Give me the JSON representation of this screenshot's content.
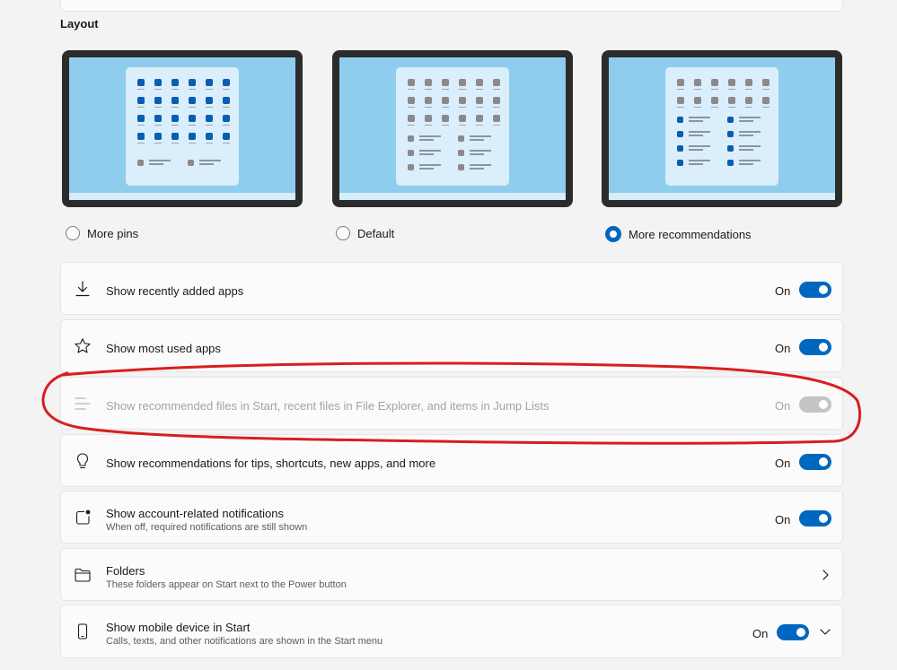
{
  "section": {
    "title": "Layout"
  },
  "layout_options": [
    {
      "label": "More pins",
      "selected": false
    },
    {
      "label": "Default",
      "selected": false
    },
    {
      "label": "More recommendations",
      "selected": true
    }
  ],
  "settings": [
    {
      "icon": "download-icon",
      "label": "Show recently added apps",
      "state": "On",
      "enabled": true
    },
    {
      "icon": "star-icon",
      "label": "Show most used apps",
      "state": "On",
      "enabled": true
    },
    {
      "icon": "list-icon",
      "label": "Show recommended files in Start, recent files in File Explorer, and items in Jump Lists",
      "state": "On",
      "enabled": false
    },
    {
      "icon": "lightbulb-icon",
      "label": "Show recommendations for tips, shortcuts, new apps, and more",
      "state": "On",
      "enabled": true
    },
    {
      "icon": "notification-icon",
      "label": "Show account-related notifications",
      "sublabel": "When off, required notifications are still shown",
      "state": "On",
      "enabled": true
    },
    {
      "icon": "folder-icon",
      "label": "Folders",
      "sublabel": "These folders appear on Start next to the Power button"
    },
    {
      "icon": "phone-icon",
      "label": "Show mobile device in Start",
      "sublabel": "Calls, texts, and other notifications are shown in the Start menu",
      "state": "On",
      "enabled": true
    }
  ],
  "colors": {
    "accent": "#0067c0",
    "annotation": "#d81e1e",
    "wallpaper": "#8ecdee"
  }
}
